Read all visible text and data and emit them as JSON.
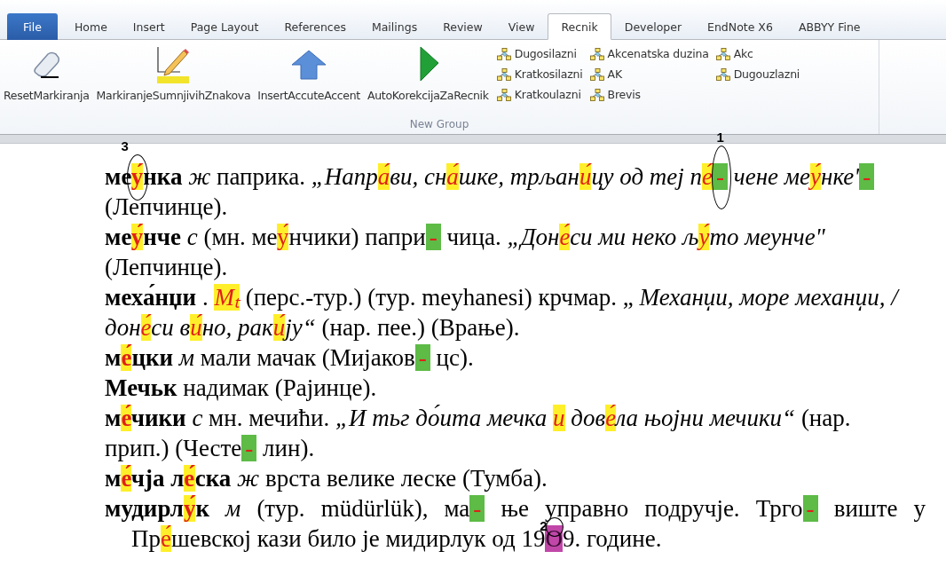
{
  "tabs": [
    {
      "label": "File",
      "kind": "file",
      "selected": false
    },
    {
      "label": "Home",
      "kind": "tab",
      "selected": false
    },
    {
      "label": "Insert",
      "kind": "tab",
      "selected": false
    },
    {
      "label": "Page Layout",
      "kind": "tab",
      "selected": false
    },
    {
      "label": "References",
      "kind": "tab",
      "selected": false
    },
    {
      "label": "Mailings",
      "kind": "tab",
      "selected": false
    },
    {
      "label": "Review",
      "kind": "tab",
      "selected": false
    },
    {
      "label": "View",
      "kind": "tab",
      "selected": false
    },
    {
      "label": "Recnik",
      "kind": "tab",
      "selected": true
    },
    {
      "label": "Developer",
      "kind": "tab",
      "selected": false
    },
    {
      "label": "EndNote X6",
      "kind": "tab",
      "selected": false
    },
    {
      "label": "ABBYY Fine",
      "kind": "tab",
      "selected": false
    }
  ],
  "ribbon": {
    "group_label": "New Group",
    "large_buttons": [
      {
        "label": "ResetMarkiranja"
      },
      {
        "label": "MarkiranjeSumnjivihZnakova"
      },
      {
        "label": "InsertAccuteAccent"
      },
      {
        "label": "AutoKorekcijaZaRecnik"
      }
    ],
    "small_button_columns": [
      [
        "Dugosilazni",
        "Kratkosilazni",
        "Kratkoulazni"
      ],
      [
        "Akcenatska duzina",
        "AK",
        "Brevis"
      ],
      [
        "Akc",
        "Dugouzlazni"
      ]
    ]
  },
  "document": {
    "lines": [
      {
        "kind": "plain",
        "segments": [
          {
            "kind": "text",
            "text": "**ме**"
          },
          {
            "kind": "accent",
            "text": "**у́**",
            "callout": "3"
          },
          {
            "kind": "text",
            "text": "**нка** *ж* паприка. *„Напр*"
          },
          {
            "kind": "accent",
            "text": "*а́*"
          },
          {
            "kind": "text",
            "text": "*ви, сн*"
          },
          {
            "kind": "accent",
            "text": "*а́*"
          },
          {
            "kind": "text",
            "text": "*шке, трљан*"
          },
          {
            "kind": "accent",
            "text": "*и́*"
          },
          {
            "kind": "text",
            "text": "*цу од теј п*"
          },
          {
            "kind": "accent",
            "text": "*е́*"
          },
          {
            "kind": "hyphen",
            "text": "-",
            "callout": "1"
          },
          {
            "kind": "text",
            "text": " *чене ме*"
          },
          {
            "kind": "accent",
            "text": "*у́*"
          },
          {
            "kind": "text",
            "text": "*нке'*"
          },
          {
            "kind": "hyphen",
            "text": "-"
          }
        ]
      },
      {
        "kind": "plain",
        "segments": [
          {
            "kind": "text",
            "text": "(Лепчинце)."
          }
        ]
      },
      {
        "kind": "plain",
        "segments": [
          {
            "kind": "text",
            "text": "**ме**"
          },
          {
            "kind": "accent",
            "text": "**у́**"
          },
          {
            "kind": "text",
            "text": "**нче** *с* (мн. ме"
          },
          {
            "kind": "accent",
            "text": "у́"
          },
          {
            "kind": "text",
            "text": "нчики) папри"
          },
          {
            "kind": "hyphen",
            "text": "-"
          },
          {
            "kind": "text",
            "text": " чица. *„Дон*"
          },
          {
            "kind": "accent",
            "text": "*е́*"
          },
          {
            "kind": "text",
            "text": "*си ми неко љ*"
          },
          {
            "kind": "accent",
            "text": "*у́*"
          },
          {
            "kind": "text",
            "text": "*то меунче\"*"
          }
        ]
      },
      {
        "kind": "plain",
        "segments": [
          {
            "kind": "text",
            "text": "(Лепчинце)."
          }
        ]
      },
      {
        "kind": "plain",
        "segments": [
          {
            "kind": "text",
            "text": "**меха́нџи** . "
          },
          {
            "kind": "accent",
            "text": "*Мₜ*"
          },
          {
            "kind": "text",
            "text": " (перс.-тур.) (тур. meyhanesi) крчмар. „ *Механџи, море механџи, /*"
          }
        ]
      },
      {
        "kind": "plain",
        "segments": [
          {
            "kind": "text",
            "text": "*дон*"
          },
          {
            "kind": "accent",
            "text": "*е́*"
          },
          {
            "kind": "text",
            "text": "*си в*"
          },
          {
            "kind": "accent",
            "text": "*и́*"
          },
          {
            "kind": "text",
            "text": "*но, рак*"
          },
          {
            "kind": "accent",
            "text": "*и́*"
          },
          {
            "kind": "text",
            "text": "*ју“* (нар. пее.) (Врање)."
          }
        ]
      },
      {
        "kind": "plain",
        "segments": [
          {
            "kind": "text",
            "text": "**м**"
          },
          {
            "kind": "accent",
            "text": "**е́**"
          },
          {
            "kind": "text",
            "text": "**цки** *м* мали мачак (Мијаков"
          },
          {
            "kind": "hyphen",
            "text": "-"
          },
          {
            "kind": "text",
            "text": " цс)."
          }
        ]
      },
      {
        "kind": "plain",
        "segments": [
          {
            "kind": "text",
            "text": "**Мечьк** надимак (Рајинце)."
          }
        ]
      },
      {
        "kind": "plain",
        "segments": [
          {
            "kind": "text",
            "text": "**м**"
          },
          {
            "kind": "accent",
            "text": "**е́**"
          },
          {
            "kind": "text",
            "text": "**чики** *с* мн. мечићи. *„И тьг до́ита мечка* "
          },
          {
            "kind": "accent",
            "text": "*и*"
          },
          {
            "kind": "text",
            "text": " *дов*"
          },
          {
            "kind": "accent",
            "text": "*е́*"
          },
          {
            "kind": "text",
            "text": "*ла њојни мечики“* (нар."
          }
        ]
      },
      {
        "kind": "plain",
        "segments": [
          {
            "kind": "text",
            "text": "прип.) (Честе"
          },
          {
            "kind": "hyphen",
            "text": "-"
          },
          {
            "kind": "text",
            "text": " лин)."
          }
        ]
      },
      {
        "kind": "plain",
        "segments": [
          {
            "kind": "text",
            "text": "**м**"
          },
          {
            "kind": "accent",
            "text": "**е́**"
          },
          {
            "kind": "text",
            "text": "**чја л**"
          },
          {
            "kind": "accent",
            "text": "**е́**"
          },
          {
            "kind": "text",
            "text": "**ска** *ж* врста велике леске (Тумба)."
          }
        ]
      },
      {
        "kind": "justified",
        "segments": [
          {
            "kind": "text",
            "text": "**мудирл**"
          },
          {
            "kind": "accent",
            "text": "**у́**"
          },
          {
            "kind": "text",
            "text": "**к** *м* (тур. müdürlük), ма"
          },
          {
            "kind": "hyphen",
            "text": "-"
          },
          {
            "kind": "text",
            "text": " ње управно подручје. Трго"
          },
          {
            "kind": "hyphen",
            "text": "-"
          },
          {
            "kind": "text",
            "text": " виште у"
          }
        ]
      },
      {
        "kind": "indented",
        "segments": [
          {
            "kind": "text",
            "text": "Пр"
          },
          {
            "kind": "accent",
            "text": "е́"
          },
          {
            "kind": "text",
            "text": "шевској кази било је мидирлук од 19"
          },
          {
            "kind": "digit",
            "text": "О",
            "callout": "2"
          },
          {
            "kind": "text",
            "text": "9. године."
          }
        ]
      }
    ]
  }
}
